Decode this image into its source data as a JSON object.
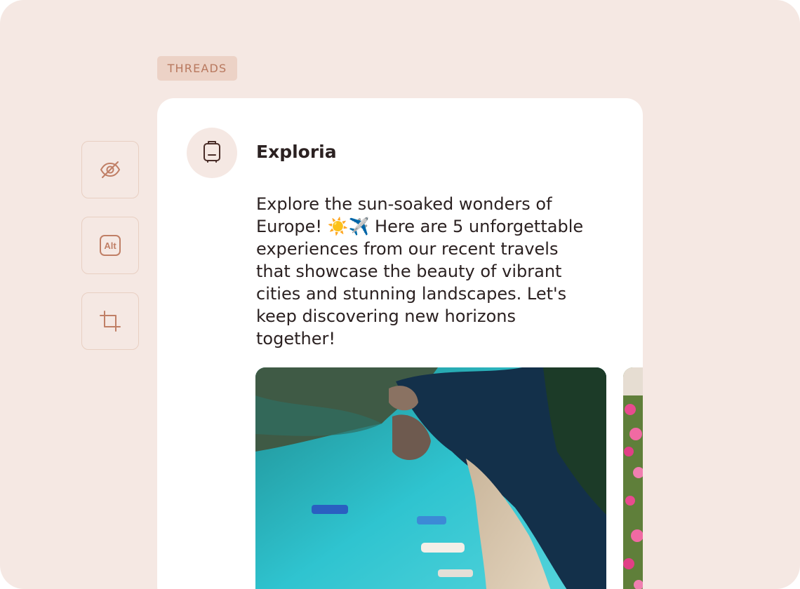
{
  "platform": {
    "badge_label": "THREADS"
  },
  "toolbar": {
    "items": [
      {
        "name": "hide",
        "icon": "eye-off-icon"
      },
      {
        "name": "alt-text",
        "icon": "alt-text-icon",
        "label": "Alt"
      },
      {
        "name": "crop",
        "icon": "crop-icon"
      }
    ]
  },
  "post": {
    "account_name": "Exploria",
    "avatar_icon": "suitcase-icon",
    "text": "Explore the sun-soaked wonders of Europe! ☀️✈️ Here are 5 unforgettable experiences from our recent travels that showcase the beauty of vibrant cities and stunning landscapes. Let's keep discovering new horizons together!",
    "media": [
      {
        "description_icon": "beach-aerial-photo"
      },
      {
        "description_icon": "flowers-photo"
      }
    ]
  },
  "colors": {
    "background": "#f5e8e3",
    "accent": "#b8785e",
    "badge_bg": "#ecd2c6",
    "card_bg": "#ffffff",
    "text": "#2b2121"
  }
}
